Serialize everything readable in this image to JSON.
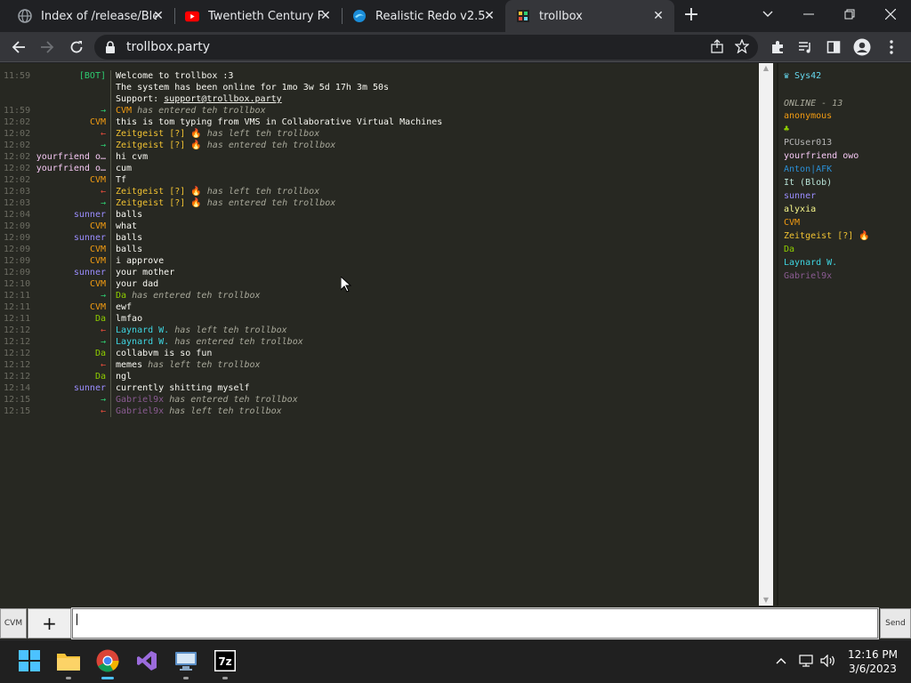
{
  "browser": {
    "tabs": [
      {
        "title": "Index of /release/Blend",
        "active": false,
        "favicon": "globe-icon"
      },
      {
        "title": "Twentieth Century Fox",
        "active": false,
        "favicon": "youtube-icon"
      },
      {
        "title": "Realistic Redo v2.5",
        "active": false,
        "favicon": "edge-icon"
      },
      {
        "title": "trollbox",
        "active": true,
        "favicon": "trollbox-icon"
      }
    ],
    "url": "trollbox.party"
  },
  "colors": {
    "bot": "#2ecc71",
    "cvm": "#f39c12",
    "joinarrow": "#2ecc71",
    "leavearrow": "#e74c3c",
    "zeitgeist": "#f1c232",
    "yourfriend": "#f7c9f5",
    "sunner": "#9b8dff",
    "da": "#8fce00",
    "laynard": "#3ed4e0",
    "gabriel": "#8a5b92",
    "anton": "#2a8fd6",
    "pcuser": "#b5b5b5",
    "it": "#b9e4d8",
    "alyxia": "#f7f78b",
    "memes": "#f8f8f2",
    "sys42": "#66d9ef"
  },
  "chat": {
    "messages": [
      {
        "time": "11:59",
        "nick": "[BOT]",
        "nick_color": "bot",
        "text": "Welcome to trollbox :3",
        "kind": "msg"
      },
      {
        "time": "",
        "nick": "",
        "nick_color": "bot",
        "text": "The system has been online for 1mo 3w 5d 17h 3m 50s",
        "kind": "msg"
      },
      {
        "time": "",
        "nick": "",
        "nick_color": "bot",
        "text_prefix": "Support: ",
        "link": "support@trollbox.party",
        "kind": "link"
      },
      {
        "time": "11:59",
        "nick": "→",
        "nick_color": "joinarrow",
        "who": "CVM",
        "who_color": "cvm",
        "text": "has entered teh trollbox",
        "kind": "sys"
      },
      {
        "time": "12:02",
        "nick": "CVM",
        "nick_color": "cvm",
        "text": "this is tom typing from VMS in Collaborative Virtual Machines",
        "kind": "msg"
      },
      {
        "time": "12:02",
        "nick": "←",
        "nick_color": "leavearrow",
        "who": "Zeitgeist [?] 🔥",
        "who_color": "zeitgeist",
        "text": "has left teh trollbox",
        "kind": "sys"
      },
      {
        "time": "12:02",
        "nick": "→",
        "nick_color": "joinarrow",
        "who": "Zeitgeist [?] 🔥",
        "who_color": "zeitgeist",
        "text": "has entered teh trollbox",
        "kind": "sys"
      },
      {
        "time": "12:02",
        "nick": "yourfriend o…",
        "nick_color": "yourfriend",
        "text": "hi cvm",
        "kind": "msg"
      },
      {
        "time": "12:02",
        "nick": "yourfriend o…",
        "nick_color": "yourfriend",
        "text": "cum",
        "kind": "msg"
      },
      {
        "time": "12:02",
        "nick": "CVM",
        "nick_color": "cvm",
        "text": "Tf",
        "kind": "msg"
      },
      {
        "time": "12:03",
        "nick": "←",
        "nick_color": "leavearrow",
        "who": "Zeitgeist [?] 🔥",
        "who_color": "zeitgeist",
        "text": "has left teh trollbox",
        "kind": "sys"
      },
      {
        "time": "12:03",
        "nick": "→",
        "nick_color": "joinarrow",
        "who": "Zeitgeist [?] 🔥",
        "who_color": "zeitgeist",
        "text": "has entered teh trollbox",
        "kind": "sys"
      },
      {
        "time": "12:04",
        "nick": "sunner",
        "nick_color": "sunner",
        "text": "balls",
        "kind": "msg"
      },
      {
        "time": "12:09",
        "nick": "CVM",
        "nick_color": "cvm",
        "text": "what",
        "kind": "msg"
      },
      {
        "time": "12:09",
        "nick": "sunner",
        "nick_color": "sunner",
        "text": "balls",
        "kind": "msg"
      },
      {
        "time": "12:09",
        "nick": "CVM",
        "nick_color": "cvm",
        "text": "balls",
        "kind": "msg"
      },
      {
        "time": "12:09",
        "nick": "CVM",
        "nick_color": "cvm",
        "text": "i approve",
        "kind": "msg"
      },
      {
        "time": "12:09",
        "nick": "sunner",
        "nick_color": "sunner",
        "text": "your mother",
        "kind": "msg"
      },
      {
        "time": "12:10",
        "nick": "CVM",
        "nick_color": "cvm",
        "text": "your dad",
        "kind": "msg"
      },
      {
        "time": "12:11",
        "nick": "→",
        "nick_color": "joinarrow",
        "who": "Da",
        "who_color": "da",
        "text": "has entered teh trollbox",
        "kind": "sys"
      },
      {
        "time": "12:11",
        "nick": "CVM",
        "nick_color": "cvm",
        "text": "ewf",
        "kind": "msg"
      },
      {
        "time": "12:11",
        "nick": "Da",
        "nick_color": "da",
        "text": "lmfao",
        "kind": "msg"
      },
      {
        "time": "12:12",
        "nick": "←",
        "nick_color": "leavearrow",
        "who": "Laynard W.",
        "who_color": "laynard",
        "text": "has left teh trollbox",
        "kind": "sys"
      },
      {
        "time": "12:12",
        "nick": "→",
        "nick_color": "joinarrow",
        "who": "Laynard W.",
        "who_color": "laynard",
        "text": "has entered teh trollbox",
        "kind": "sys"
      },
      {
        "time": "12:12",
        "nick": "Da",
        "nick_color": "da",
        "text": "collabvm is so fun",
        "kind": "msg"
      },
      {
        "time": "12:12",
        "nick": "←",
        "nick_color": "leavearrow",
        "who": "memes",
        "who_color": "memes",
        "text": "has left teh trollbox",
        "kind": "sys"
      },
      {
        "time": "12:12",
        "nick": "Da",
        "nick_color": "da",
        "text": "ngl",
        "kind": "msg"
      },
      {
        "time": "12:14",
        "nick": "sunner",
        "nick_color": "sunner",
        "text": "currently shitting myself",
        "kind": "msg"
      },
      {
        "time": "12:15",
        "nick": "→",
        "nick_color": "joinarrow",
        "who": "Gabriel9x",
        "who_color": "gabriel",
        "text": "has entered teh trollbox",
        "kind": "sys"
      },
      {
        "time": "12:15",
        "nick": "←",
        "nick_color": "leavearrow",
        "who": "Gabriel9x",
        "who_color": "gabriel",
        "text": "has left teh trollbox",
        "kind": "sys"
      }
    ]
  },
  "userlist": {
    "me": "♛ Sys42",
    "online_label": "ONLINE - 13",
    "users": [
      {
        "name": "anonymous",
        "color": "cvm"
      },
      {
        "name": "♣",
        "color": "da"
      },
      {
        "name": "PCUser013",
        "color": "pcuser"
      },
      {
        "name": "yourfriend owo",
        "color": "yourfriend"
      },
      {
        "name": "Anton|AFK",
        "color": "anton"
      },
      {
        "name": "It (Blob)",
        "color": "it"
      },
      {
        "name": "sunner",
        "color": "sunner"
      },
      {
        "name": "alyxia",
        "color": "alyxia"
      },
      {
        "name": "CVM",
        "color": "cvm"
      },
      {
        "name": "Zeitgeist [?] 🔥",
        "color": "zeitgeist"
      },
      {
        "name": "Da",
        "color": "da"
      },
      {
        "name": "Laynard W.",
        "color": "laynard"
      },
      {
        "name": "Gabriel9x",
        "color": "gabriel"
      }
    ]
  },
  "input": {
    "nick_button": "CVM",
    "plus_button": "+",
    "value": "",
    "send_button": "Send"
  },
  "taskbar": {
    "time": "12:16 PM",
    "date": "3/6/2023"
  }
}
